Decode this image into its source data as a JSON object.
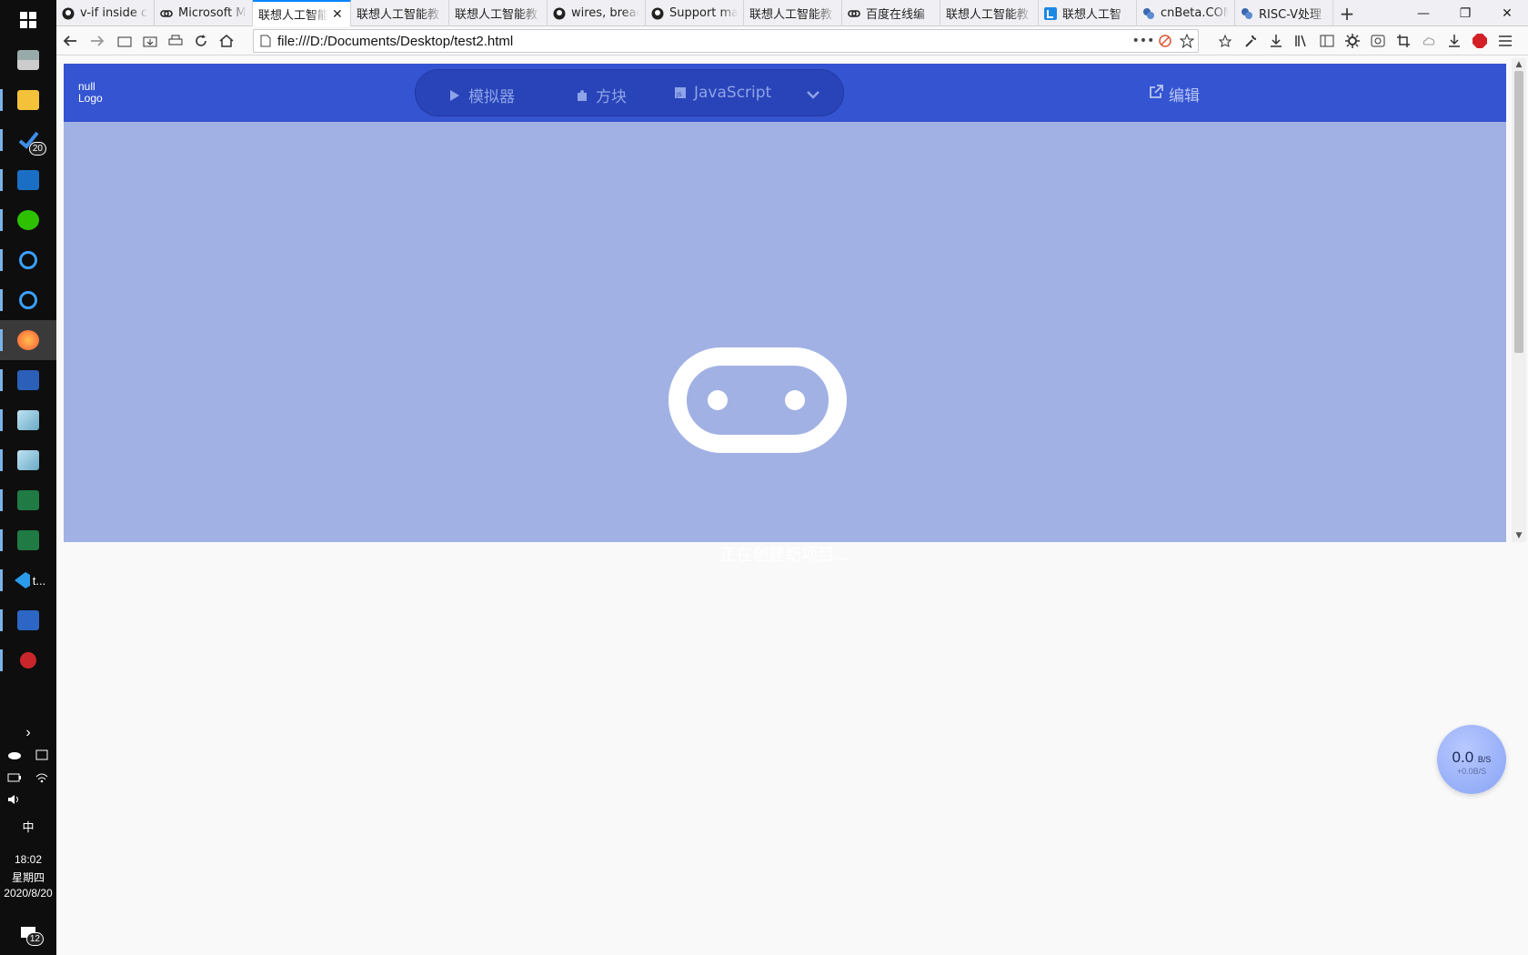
{
  "browser": {
    "tabs": [
      {
        "title": "v-if inside c",
        "favicon": "github-icon"
      },
      {
        "title": "Microsoft M",
        "favicon": "link-icon"
      },
      {
        "title": "联想人工智能",
        "favicon": "none",
        "active": true
      },
      {
        "title": "联想人工智能教",
        "favicon": "none"
      },
      {
        "title": "联想人工智能教",
        "favicon": "none"
      },
      {
        "title": "wires, breac",
        "favicon": "github-icon"
      },
      {
        "title": "Support ma",
        "favicon": "github-icon"
      },
      {
        "title": "联想人工智能教",
        "favicon": "none"
      },
      {
        "title": "百度在线编",
        "favicon": "link-icon"
      },
      {
        "title": "联想人工智能教",
        "favicon": "none"
      },
      {
        "title": "联想人工智",
        "favicon": "l-icon"
      },
      {
        "title": "cnBeta.COM",
        "favicon": "cnbeta-icon"
      },
      {
        "title": "RISC-V处理",
        "favicon": "cnbeta-icon"
      }
    ],
    "new_tab_label": "+",
    "url": "file:///D:/Documents/Desktop/test2.html"
  },
  "app": {
    "logo_line1": "null",
    "logo_line2": "Logo",
    "tabs": [
      {
        "label": "模拟器",
        "icon": "play-icon"
      },
      {
        "label": "方块",
        "icon": "puzzle-icon"
      },
      {
        "label": "JavaScript",
        "icon": "js-file-icon"
      }
    ],
    "edit_label": "编辑",
    "loading_text": "正在创建新项目..."
  },
  "taskbar": {
    "todo_badge": "20",
    "vscode_label": "t...",
    "ime": "中",
    "time": "18:02",
    "weekday": "星期四",
    "date": "2020/8/20",
    "notif_count": "12"
  },
  "speed_widget": {
    "value": "0.0",
    "unit": "B/S",
    "sub": "+0.0B/S"
  },
  "colors": {
    "header": "#3454d1",
    "loading_bg": "#a1b1e4",
    "accent": "#0a84ff"
  }
}
